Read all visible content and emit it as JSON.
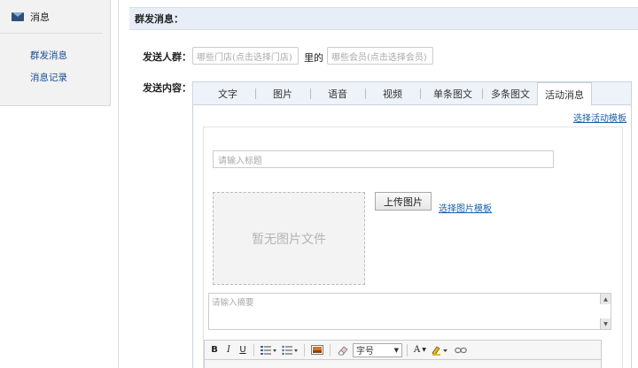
{
  "sidebar": {
    "title": "消息",
    "items": [
      {
        "label": "群发消息"
      },
      {
        "label": "消息记录"
      }
    ]
  },
  "section": {
    "title": "群发消息："
  },
  "form": {
    "recipients_label": "发送人群：",
    "store_placeholder": "哪些门店(点击选择门店)",
    "connector": "里的",
    "member_placeholder": "哪些会员(点击选择会员)",
    "content_label": "发送内容："
  },
  "tabs": [
    {
      "label": "文字"
    },
    {
      "label": "图片"
    },
    {
      "label": "语音"
    },
    {
      "label": "视频"
    },
    {
      "label": "单条图文"
    },
    {
      "label": "多条图文"
    },
    {
      "label": "活动消息"
    }
  ],
  "active_tab": "活动消息",
  "activity": {
    "template_link": "选择活动模板",
    "title_placeholder": "请输入标题",
    "no_image_text": "暂无图片文件",
    "upload_button": "上传图片",
    "image_template_link": "选择图片模板",
    "summary_placeholder": "请输入摘要"
  },
  "editor_toolbar": {
    "bold": "B",
    "italic": "I",
    "underline": "U",
    "font_size_select": "字号",
    "font_color": "A"
  },
  "colors": {
    "section_bar": "#e8eef7",
    "link": "#1a5ea8",
    "sidebar_link": "#1a4c8c"
  }
}
